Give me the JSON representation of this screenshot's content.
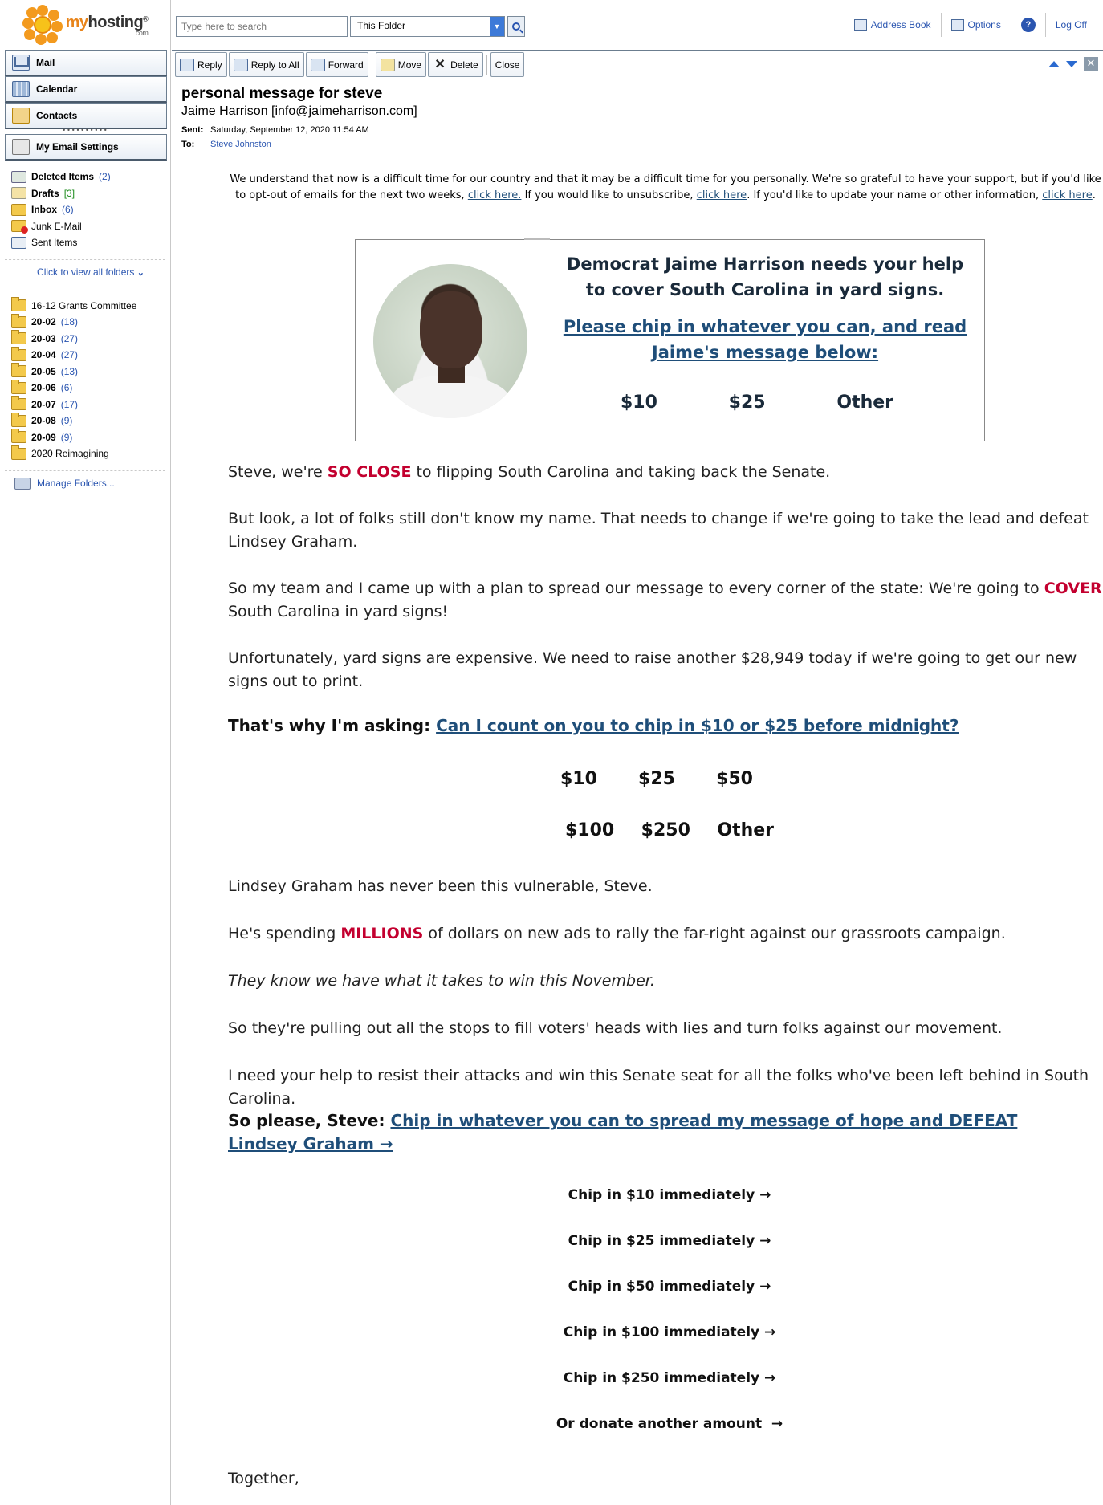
{
  "logo": {
    "brand_my": "my",
    "brand_hosting": "hosting",
    "brand_sup": "®",
    "brand_com": ".com"
  },
  "search": {
    "placeholder": "Type here to search",
    "scope": "This Folder"
  },
  "top_links": [
    {
      "label": "Address Book",
      "icon": "address-book-icon"
    },
    {
      "label": "Options",
      "icon": "options-icon"
    },
    {
      "label": "?",
      "icon": "help-icon"
    },
    {
      "label": "Log Off",
      "icon": ""
    }
  ],
  "nav": [
    {
      "label": "Mail",
      "icon": "mail-icon"
    },
    {
      "label": "Calendar",
      "icon": "calendar-icon"
    },
    {
      "label": "Contacts",
      "icon": "contacts-icon"
    },
    {
      "label": "My Email Settings",
      "icon": "settings-icon"
    }
  ],
  "nav_dots": "••••••••••",
  "special_folders": [
    {
      "name": "Deleted Items",
      "count": "(2)",
      "bold": true
    },
    {
      "name": "Drafts",
      "count": "[3]",
      "bold": true
    },
    {
      "name": "Inbox",
      "count": "(6)",
      "bold": true
    },
    {
      "name": "Junk E-Mail",
      "count": "",
      "bold": false
    },
    {
      "name": "Sent Items",
      "count": "",
      "bold": false
    }
  ],
  "view_all": "Click to view all folders",
  "folders": [
    {
      "name": "16-12 Grants Committee",
      "count": ""
    },
    {
      "name": "20-02",
      "count": "(18)"
    },
    {
      "name": "20-03",
      "count": "(27)"
    },
    {
      "name": "20-04",
      "count": "(27)"
    },
    {
      "name": "20-05",
      "count": "(13)"
    },
    {
      "name": "20-06",
      "count": "(6)"
    },
    {
      "name": "20-07",
      "count": "(17)"
    },
    {
      "name": "20-08",
      "count": "(9)"
    },
    {
      "name": "20-09",
      "count": "(9)"
    },
    {
      "name": "2020 Reimagining",
      "count": ""
    }
  ],
  "manage_folders": "Manage Folders...",
  "toolbar": {
    "reply": "Reply",
    "reply_all": "Reply to All",
    "forward": "Forward",
    "move": "Move",
    "delete": "Delete",
    "close": "Close"
  },
  "message": {
    "subject": "personal message for steve",
    "from": "Jaime Harrison [info@jaimeharrison.com]",
    "sent_label": "Sent:",
    "sent": "Saturday, September 12, 2020 11:54 AM",
    "to_label": "To:",
    "to": "Steve Johnston"
  },
  "notice": {
    "part1": "We understand that now is a difficult time for our country and that it may be a difficult time for you personally. We're so grateful to have your support, but if you'd like to opt-out of emails for the next two weeks,",
    "link1": "click here.",
    "part2": "If you would like to unsubscribe,",
    "link2": "click here",
    "part3": ". If you'd like to update your name or other information,",
    "link3": "click here",
    "part4": "."
  },
  "card": {
    "headline": "Democrat Jaime Harrison needs your help to cover South Carolina in yard signs.",
    "link": "Please chip in whatever you can, and read Jaime's message below:",
    "amounts": [
      "$10",
      "$25",
      "Other"
    ]
  },
  "paragraphs": {
    "p1_a": "Steve, we're ",
    "p1_red": "SO CLOSE",
    "p1_b": " to flipping South Carolina and taking back the Senate.",
    "p2": "But look, a lot of folks still don't know my name. That needs to change if we're going to take the lead and defeat Lindsey Graham.",
    "p3_a": "So my team and I came up with a plan to spread our message to every corner of the state: We're going to ",
    "p3_red": "COVER",
    "p3_b": " South Carolina in yard signs!",
    "p4": "Unfortunately, yard signs are expensive. We need to raise another $28,949 today if we're going to get our new signs out to print.",
    "p5_bold": "That's why I'm asking: ",
    "p5_link": "Can I count on you to chip in $10 or $25 before midnight?",
    "p6": "Lindsey Graham has never been this vulnerable, Steve.",
    "p7_a": "He's spending ",
    "p7_red": "MILLIONS",
    "p7_b": " of dollars on new ads to rally the far-right against our grassroots campaign.",
    "p8": "They know we have what it takes to win this November.",
    "p9": "So they're pulling out all the stops to fill voters' heads with lies and turn folks against our movement.",
    "p10": "I need your help to resist their attacks and win this Senate seat for all the folks who've been left behind in South Carolina.",
    "p11_bold": "So please, Steve: ",
    "p11_link": "Chip in whatever you can to spread my message of hope and DEFEAT Lindsey Graham →",
    "closing": "Together,"
  },
  "amount_grid": [
    [
      "$10",
      "$25",
      "$50"
    ],
    [
      "$100",
      "$250",
      "Other"
    ]
  ],
  "chip_links": [
    "Chip in $10 immediately →",
    "Chip in $25 immediately →",
    "Chip in $50 immediately →",
    "Chip in $100 immediately →",
    "Chip in $250 immediately →",
    "Or donate another amount  →"
  ],
  "colors": {
    "accent_red": "#c3002f",
    "link_blue": "#1f4e79",
    "ui_blue": "#2a55b0"
  }
}
